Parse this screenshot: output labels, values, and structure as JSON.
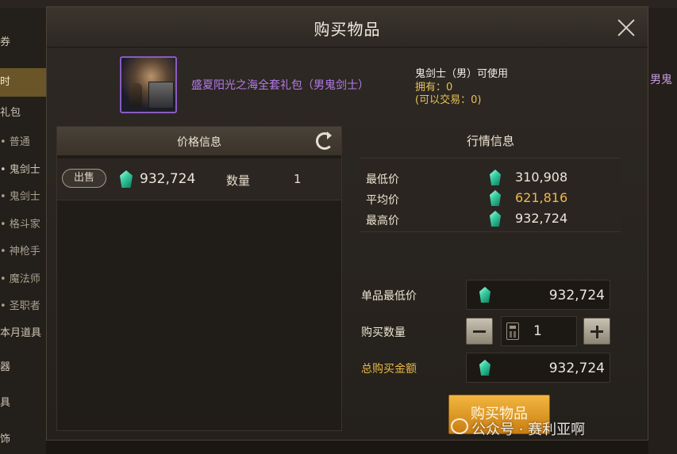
{
  "background": {
    "sidebar_items": [
      "券",
      "时",
      "礼包",
      "• 普通",
      "• 鬼剑士",
      "• 鬼剑士",
      "• 格斗家",
      "• 神枪手",
      "• 魔法师",
      "• 圣职者",
      "本月道具",
      "器",
      "具",
      "饰"
    ],
    "right_text": "男鬼"
  },
  "dialog": {
    "title": "购买物品",
    "item": {
      "name": "盛夏阳光之海全套礼包（男鬼剑士）",
      "usable_by": "鬼剑士（男）可使用",
      "owned": "拥有：0",
      "tradable": "(可以交易：0)"
    },
    "price_panel": {
      "header": "价格信息",
      "listings": [
        {
          "tag": "出售",
          "price": "932,724",
          "qty_label": "数量",
          "qty": "1"
        }
      ]
    },
    "market": {
      "header": "行情信息",
      "rows": [
        {
          "label": "最低价",
          "value": "310,908"
        },
        {
          "label": "平均价",
          "value": "621,816"
        },
        {
          "label": "最高价",
          "value": "932,724"
        }
      ]
    },
    "form": {
      "unit_min_label": "单品最低价",
      "unit_min_value": "932,724",
      "qty_label": "购买数量",
      "qty_value": "1",
      "total_label": "总购买金额",
      "total_value": "932,724"
    },
    "buy_button": "购买物品"
  },
  "watermark": "公众号 · 赛利亚啊",
  "colors": {
    "accent_gold": "#f0b74c",
    "item_purple": "#b57bea",
    "gem_green": "#3bd0a4",
    "button_orange": "#e39a25"
  }
}
